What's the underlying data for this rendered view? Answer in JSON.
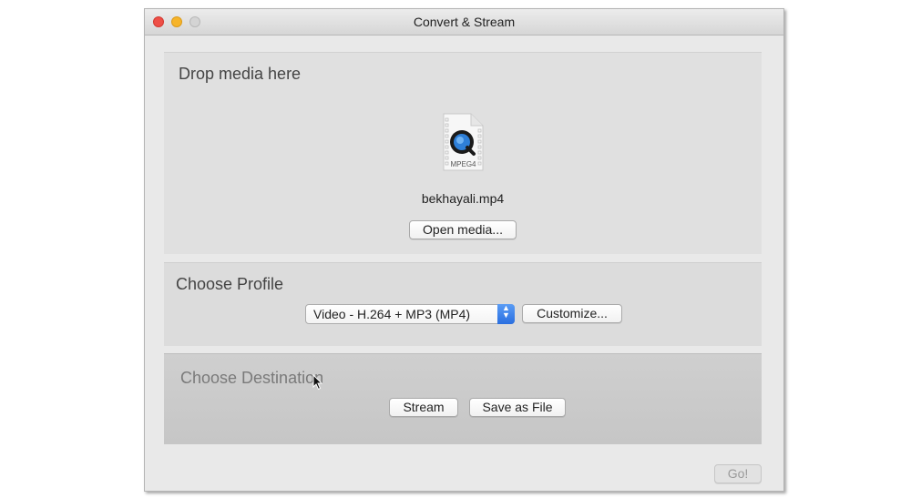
{
  "window": {
    "title": "Convert & Stream",
    "controls": [
      "close",
      "minimize",
      "zoom"
    ]
  },
  "drop_panel": {
    "heading": "Drop media here",
    "file_icon": "mpeg4-file-icon",
    "file_icon_label": "MPEG4",
    "file_name": "bekhayali.mp4",
    "open_button": "Open media..."
  },
  "profile_panel": {
    "heading": "Choose Profile",
    "selected_profile": "Video - H.264 + MP3 (MP4)",
    "customize_button": "Customize..."
  },
  "destination_panel": {
    "heading": "Choose Destination",
    "stream_button": "Stream",
    "save_button": "Save as File"
  },
  "footer": {
    "go_button": "Go!"
  },
  "colors": {
    "close": "#ee4f47",
    "minimize": "#f6b42a",
    "select_accent": "#2a6fe0"
  }
}
